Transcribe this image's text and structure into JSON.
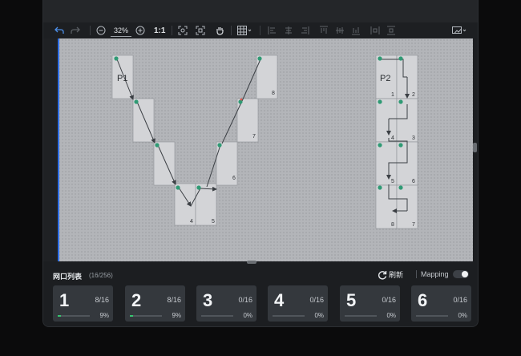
{
  "toolbar": {
    "zoom_value": "32%",
    "actual_size_label": "1:1"
  },
  "canvas": {
    "groups": [
      {
        "label": "P1",
        "ports": [
          {
            "id": "1",
            "label": ""
          },
          {
            "id": "2",
            "label": ""
          },
          {
            "id": "3",
            "label": ""
          },
          {
            "id": "4",
            "label": "4"
          },
          {
            "id": "5",
            "label": "5"
          },
          {
            "id": "6",
            "label": "6"
          },
          {
            "id": "7",
            "label": "7"
          },
          {
            "id": "8",
            "label": "8"
          }
        ]
      },
      {
        "label": "P2",
        "ports": [
          {
            "id": "1",
            "label": "1"
          },
          {
            "id": "2",
            "label": "2"
          },
          {
            "id": "3",
            "label": "3"
          },
          {
            "id": "4",
            "label": "4"
          },
          {
            "id": "5",
            "label": "5"
          },
          {
            "id": "6",
            "label": "6"
          },
          {
            "id": "7",
            "label": "7"
          },
          {
            "id": "8",
            "label": "8"
          }
        ]
      }
    ]
  },
  "panel": {
    "title": "网口列表",
    "count": "(16/256)",
    "refresh_label": "刷新",
    "mapping_label": "Mapping",
    "mapping_enabled": false
  },
  "ports": [
    {
      "number": "1",
      "ratio": "8/16",
      "percent": "9%",
      "progress": 0.09
    },
    {
      "number": "2",
      "ratio": "8/16",
      "percent": "9%",
      "progress": 0.09
    },
    {
      "number": "3",
      "ratio": "0/16",
      "percent": "0%",
      "progress": 0
    },
    {
      "number": "4",
      "ratio": "0/16",
      "percent": "0%",
      "progress": 0
    },
    {
      "number": "5",
      "ratio": "0/16",
      "percent": "0%",
      "progress": 0
    },
    {
      "number": "6",
      "ratio": "0/16",
      "percent": "0%",
      "progress": 0
    }
  ],
  "colors": {
    "accent_green": "#37c46f",
    "node_dot": "#2f9a74",
    "selection_edge": "#2f6fe8"
  }
}
